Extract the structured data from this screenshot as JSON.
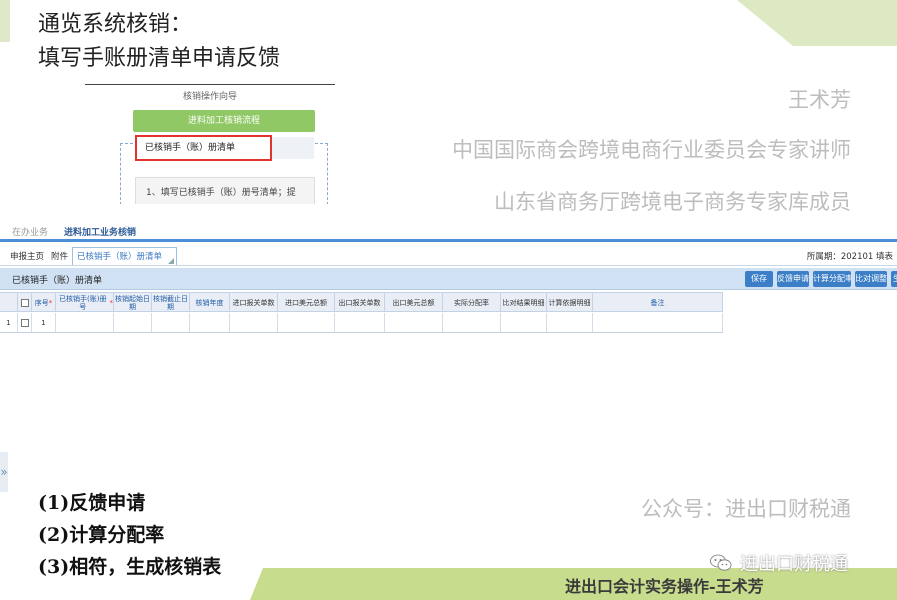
{
  "slide": {
    "title_line1": "通览系统核销：",
    "title_line2": "填写手账册清单申请反馈",
    "credits": {
      "name": "王术芳",
      "role1": "中国国际商会跨境电商行业委员会专家讲师",
      "role2": "山东省商务厅跨境电子商务专家库成员",
      "wechat_account": "公众号：进出口财税通"
    },
    "steps": [
      "(1)反馈申请",
      "(2)计算分配率",
      "(3)相符，生成核销表"
    ],
    "footer": "进出口会计实务操作-王术芳",
    "wechat_label": "进出口财税通"
  },
  "wizard": {
    "title": "核销操作向导",
    "flow_button": "进料加工核销流程",
    "highlighted_item": "已核销手（账）册清单",
    "step1": "1、填写已核销手（账）册号清单；提"
  },
  "app": {
    "nav": {
      "pending": "在办业务",
      "active": "进料加工业务核销",
      "close_symbol": "ⓧ"
    },
    "tabs": {
      "home": "申报主页",
      "attachment": "附件",
      "current": "已核销手（账）册清单",
      "period": "所属期：202101  填表"
    },
    "panel_title": "已核销手（账）册清单",
    "toolbar": {
      "save": "保存",
      "feedback": "反馈申请",
      "calc_rate": "计算分配率",
      "compare_adjust": "比对调整",
      "more": "生成"
    },
    "grid": {
      "columns": [
        "序号",
        "已核销手(账)册号",
        "核销起始日期",
        "核销截止日期",
        "核销年度",
        "进口报关单数",
        "进口美元总额",
        "出口报关单数",
        "出口美元总额",
        "实际分配率",
        "比对结果明细",
        "计算依据明细",
        "备注"
      ],
      "rows": [
        {
          "row_num": "1",
          "seq": "1"
        }
      ]
    },
    "expander_symbol": "»"
  },
  "colors": {
    "accent_green": "#8fc864",
    "bottom_band": "#c8dc8e",
    "primary_blue": "#3c7fc7",
    "highlight_red": "#e1342d"
  }
}
